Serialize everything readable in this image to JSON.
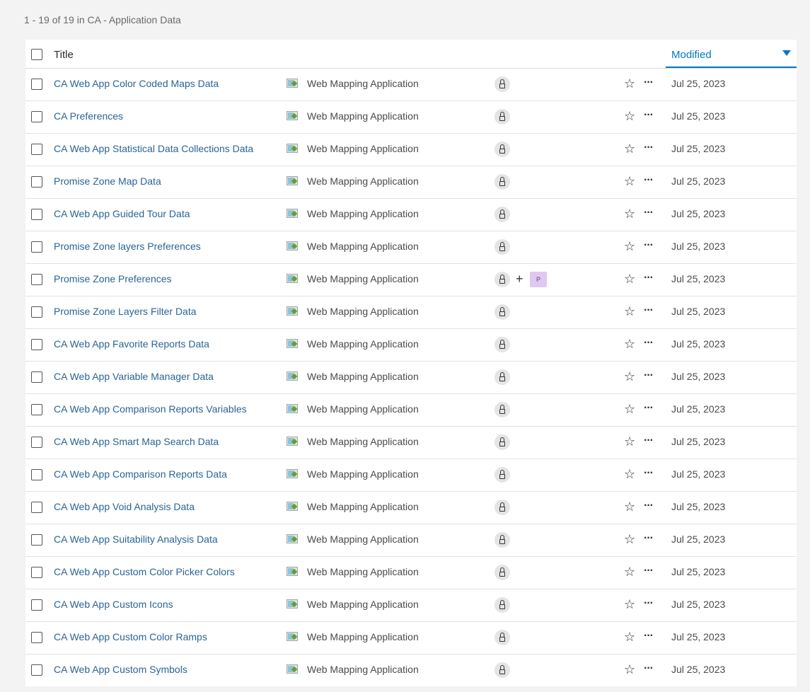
{
  "summary": "1 - 19 of 19 in CA - Application Data",
  "table": {
    "title_header": "Title",
    "modified_header": "Modified",
    "rows": [
      {
        "title": "CA Web App Color Coded Maps Data",
        "type": "Web Mapping Application",
        "date": "Jul 25, 2023",
        "group": ""
      },
      {
        "title": "CA Preferences",
        "type": "Web Mapping Application",
        "date": "Jul 25, 2023",
        "group": ""
      },
      {
        "title": "CA Web App Statistical Data Collections Data",
        "type": "Web Mapping Application",
        "date": "Jul 25, 2023",
        "group": ""
      },
      {
        "title": "Promise Zone Map Data",
        "type": "Web Mapping Application",
        "date": "Jul 25, 2023",
        "group": ""
      },
      {
        "title": "CA Web App Guided Tour Data",
        "type": "Web Mapping Application",
        "date": "Jul 25, 2023",
        "group": ""
      },
      {
        "title": "Promise Zone layers Preferences",
        "type": "Web Mapping Application",
        "date": "Jul 25, 2023",
        "group": ""
      },
      {
        "title": "Promise Zone Preferences",
        "type": "Web Mapping Application",
        "date": "Jul 25, 2023",
        "group": "P"
      },
      {
        "title": "Promise Zone Layers Filter Data",
        "type": "Web Mapping Application",
        "date": "Jul 25, 2023",
        "group": ""
      },
      {
        "title": "CA Web App Favorite Reports Data",
        "type": "Web Mapping Application",
        "date": "Jul 25, 2023",
        "group": ""
      },
      {
        "title": "CA Web App Variable Manager Data",
        "type": "Web Mapping Application",
        "date": "Jul 25, 2023",
        "group": ""
      },
      {
        "title": "CA Web App Comparison Reports Variables",
        "type": "Web Mapping Application",
        "date": "Jul 25, 2023",
        "group": ""
      },
      {
        "title": "CA Web App Smart Map Search Data",
        "type": "Web Mapping Application",
        "date": "Jul 25, 2023",
        "group": ""
      },
      {
        "title": "CA Web App Comparison Reports Data",
        "type": "Web Mapping Application",
        "date": "Jul 25, 2023",
        "group": ""
      },
      {
        "title": "CA Web App Void Analysis Data",
        "type": "Web Mapping Application",
        "date": "Jul 25, 2023",
        "group": ""
      },
      {
        "title": "CA Web App Suitability Analysis Data",
        "type": "Web Mapping Application",
        "date": "Jul 25, 2023",
        "group": ""
      },
      {
        "title": "CA Web App Custom Color Picker Colors",
        "type": "Web Mapping Application",
        "date": "Jul 25, 2023",
        "group": ""
      },
      {
        "title": "CA Web App Custom Icons",
        "type": "Web Mapping Application",
        "date": "Jul 25, 2023",
        "group": ""
      },
      {
        "title": "CA Web App Custom Color Ramps",
        "type": "Web Mapping Application",
        "date": "Jul 25, 2023",
        "group": ""
      },
      {
        "title": "CA Web App Custom Symbols",
        "type": "Web Mapping Application",
        "date": "Jul 25, 2023",
        "group": ""
      }
    ]
  },
  "icons": {
    "type_icon": "web-mapping-application-icon",
    "sharing_icon": "lock-icon",
    "favorite_icon": "star-icon",
    "more_icon": "more-options-icon",
    "sort_icon": "sort-descending-icon"
  },
  "colors": {
    "link": "#2a6496",
    "accent": "#0079c1",
    "group_badge": "#e1c8f0"
  }
}
